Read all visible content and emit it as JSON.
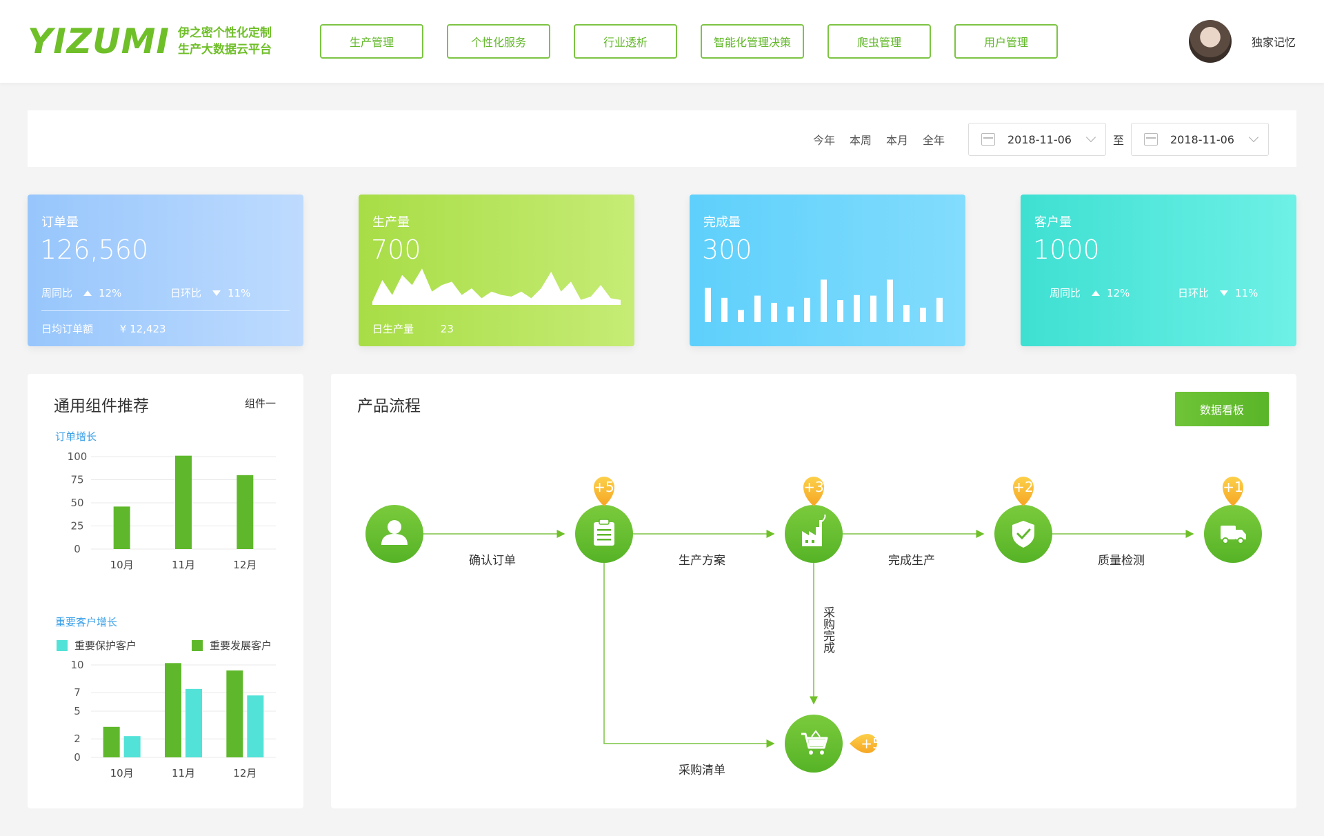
{
  "header": {
    "logo_text": "YIZUMI",
    "logo_sub1": "伊之密个性化定制",
    "logo_sub2": "生产大数据云平台",
    "nav": [
      "生产管理",
      "个性化服务",
      "行业透析",
      "智能化管理决策",
      "爬虫管理",
      "用户管理"
    ],
    "username": "独家记忆"
  },
  "filter": {
    "ranges": [
      "今年",
      "本周",
      "本月",
      "全年"
    ],
    "date_from": "2018-11-06",
    "date_to": "2018-11-06",
    "to_label": "至"
  },
  "cards": {
    "orders": {
      "label": "订单量",
      "value": "126,560",
      "week_label": "周同比",
      "week_value": "12%",
      "day_label": "日环比",
      "day_value": "11%",
      "foot_label": "日均订单额",
      "foot_value": "¥ 12,423"
    },
    "production": {
      "label": "生产量",
      "value": "700",
      "foot_label": "日生产量",
      "foot_value": "23"
    },
    "completed": {
      "label": "完成量",
      "value": "300"
    },
    "customers": {
      "label": "客户量",
      "value": "1000",
      "week_label": "周同比",
      "week_value": "12%",
      "day_label": "日环比",
      "day_value": "11%"
    }
  },
  "left_panel": {
    "title": "通用组件推荐",
    "more": "组件一",
    "chart1_title": "订单增长",
    "chart2_title": "重要客户增长",
    "legend": [
      "重要保护客户",
      "重要发展客户"
    ]
  },
  "right_panel": {
    "title": "产品流程",
    "board_button": "数据看板",
    "steps": [
      "确认订单",
      "生产方案",
      "完成生产",
      "质量检测"
    ],
    "branch_down_label": "采购完成",
    "branch_label": "采购清单",
    "badges": [
      "+5",
      "+3",
      "+2",
      "+1",
      "+5"
    ]
  },
  "chart_data": [
    {
      "type": "bar",
      "title": "订单增长",
      "categories": [
        "10月",
        "11月",
        "12月"
      ],
      "values": [
        46,
        101,
        80
      ],
      "ylim": [
        0,
        100
      ],
      "yticks": [
        0,
        25,
        50,
        75,
        100
      ],
      "colors": [
        "#5fb82b"
      ]
    },
    {
      "type": "bar",
      "title": "重要客户增长",
      "categories": [
        "10月",
        "11月",
        "12月"
      ],
      "series": [
        {
          "name": "重要保护客户",
          "values": [
            3.3,
            10.2,
            9.4
          ],
          "color": "#5fb82b"
        },
        {
          "name": "重要发展客户",
          "values": [
            2.3,
            7.4,
            6.7
          ],
          "color": "#52e2d8"
        }
      ],
      "ylim": [
        0,
        10
      ],
      "yticks": [
        0,
        2,
        5,
        7,
        10
      ]
    },
    {
      "type": "area",
      "title": "",
      "values": [
        2,
        15,
        6,
        18,
        12,
        22,
        8,
        12,
        14,
        6,
        10,
        4,
        8,
        6,
        5,
        8,
        4,
        10,
        20,
        8,
        14,
        3,
        5,
        12,
        4,
        3
      ],
      "ylim": [
        0,
        25
      ]
    },
    {
      "type": "bar",
      "title": "",
      "values": [
        62,
        44,
        22,
        48,
        35,
        28,
        44,
        77,
        40,
        49,
        48,
        77,
        31,
        26,
        44
      ],
      "ylim": [
        0,
        100
      ]
    }
  ],
  "colors": {
    "brand": "#6fbf29",
    "badge": "#f8b22c",
    "node": "#5eb82a"
  }
}
